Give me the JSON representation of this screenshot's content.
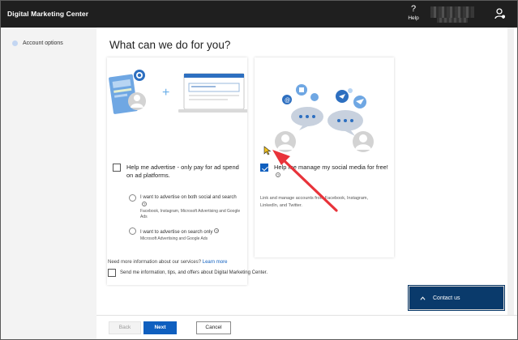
{
  "app": {
    "title": "Digital Marketing Center"
  },
  "topbar": {
    "help_icon": "?",
    "help_label": "Help"
  },
  "sidebar": {
    "items": [
      {
        "label": "Account options"
      }
    ]
  },
  "main": {
    "heading": "What can we do for you?",
    "option_ads": {
      "checked": false,
      "title": "Help me advertise - only pay for ad spend on ad platforms.",
      "radios": [
        {
          "label": "I want to advertise on both social and search",
          "sub": "Facebook, Instagram, Microsoft Advertising and Google Ads"
        },
        {
          "label": "I want to advertise on search only",
          "sub": "Microsoft Advertising and Google Ads"
        }
      ]
    },
    "option_social": {
      "checked": true,
      "title": "Help me manage my social media for free!",
      "description": "Link and manage accounts from Facebook, Instagram, LinkedIn, and Twitter."
    },
    "info_glyph": "?",
    "more_info": {
      "text": "Need more information about our services?",
      "link": "Learn more"
    },
    "consent": {
      "checked": false,
      "label": "Send me information, tips, and offers about Digital Marketing Center."
    }
  },
  "footer": {
    "back": "Back",
    "next": "Next",
    "cancel": "Cancel"
  },
  "contact": {
    "label": "Contact us"
  },
  "colors": {
    "topbar": "#1f1f1f",
    "accent": "#0f5fbf",
    "contact": "#0a3a6b",
    "annotation_arrow": "#e8333a"
  }
}
